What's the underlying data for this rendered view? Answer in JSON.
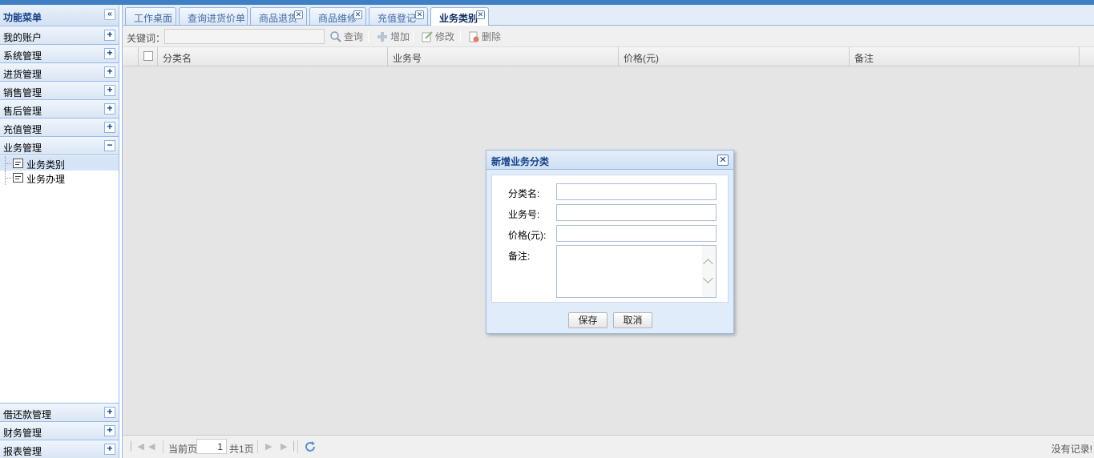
{
  "sidebar": {
    "title": "功能菜单",
    "collapse_glyph": "«",
    "groups": [
      {
        "label": "我的账户",
        "tool": "+"
      },
      {
        "label": "系统管理",
        "tool": "+"
      },
      {
        "label": "进货管理",
        "tool": "+"
      },
      {
        "label": "销售管理",
        "tool": "+"
      },
      {
        "label": "售后管理",
        "tool": "+"
      },
      {
        "label": "充值管理",
        "tool": "+"
      },
      {
        "label": "业务管理",
        "tool": "−"
      }
    ],
    "tree_items": [
      {
        "label": "业务类别"
      },
      {
        "label": "业务办理"
      }
    ],
    "bottom_groups": [
      {
        "label": "借还款管理",
        "tool": "+"
      },
      {
        "label": "财务管理",
        "tool": "+"
      },
      {
        "label": "报表管理",
        "tool": "+"
      }
    ]
  },
  "tabs": [
    {
      "label": "工作桌面"
    },
    {
      "label": "查询进货价单"
    },
    {
      "label": "商品退货"
    },
    {
      "label": "商品维修"
    },
    {
      "label": "充值登记"
    },
    {
      "label": "业务类别"
    }
  ],
  "tab_close_glyph": "✕",
  "toolbar": {
    "keyword_label": "关键词：",
    "search_label": "查询",
    "add_label": "增加",
    "edit_label": "修改",
    "delete_label": "删除"
  },
  "grid": {
    "columns": [
      "分类名",
      "业务号",
      "价格(元)",
      "备注"
    ]
  },
  "pager": {
    "current_page_label": "当前页",
    "current_page": "1",
    "total_label": "共1页",
    "empty_text": "没有记录!"
  },
  "dialog": {
    "title": "新增业务分类",
    "close_glyph": "✕",
    "fields": {
      "name_label": "分类名:",
      "code_label": "业务号:",
      "price_label": "价格(元):",
      "remark_label": "备注:"
    },
    "save_label": "保存",
    "cancel_label": "取消"
  }
}
